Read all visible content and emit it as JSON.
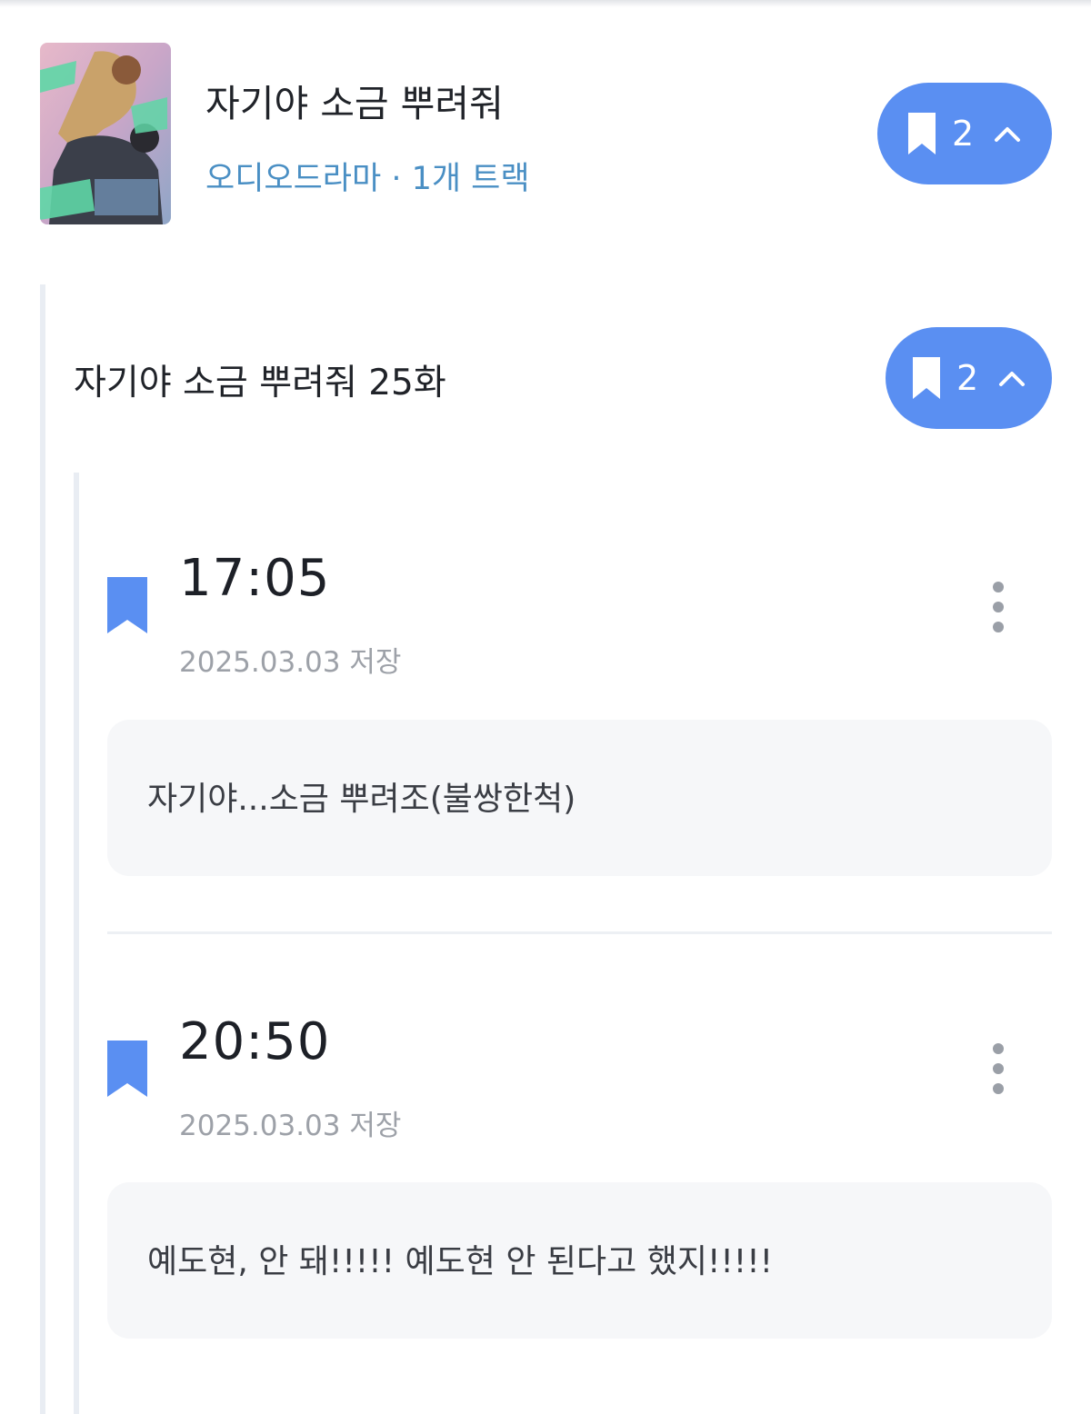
{
  "album": {
    "title": "자기야 소금 뿌려줘",
    "meta": "오디오드라마 · 1개 트랙",
    "bookmark_count": "2",
    "cover_icon": "album-cover-art"
  },
  "episode": {
    "title": "자기야 소금 뿌려줘 25화",
    "bookmark_count": "2"
  },
  "bookmarks": [
    {
      "time": "17:05",
      "date": "2025.03.03 저장",
      "memo": "자기야...소금 뿌려조(불쌍한척)"
    },
    {
      "time": "20:50",
      "date": "2025.03.03 저장",
      "memo": "예도현, 안 돼!!!!! 예도현 안 된다고 했지!!!!!"
    }
  ],
  "colors": {
    "accent": "#5a8ff2",
    "meta_text": "#4a8fc4",
    "memo_bg": "#f6f7f9",
    "guide_line": "#e9edf3"
  },
  "icons": [
    "bookmark-icon",
    "chevron-up-icon",
    "more-vertical-icon"
  ]
}
